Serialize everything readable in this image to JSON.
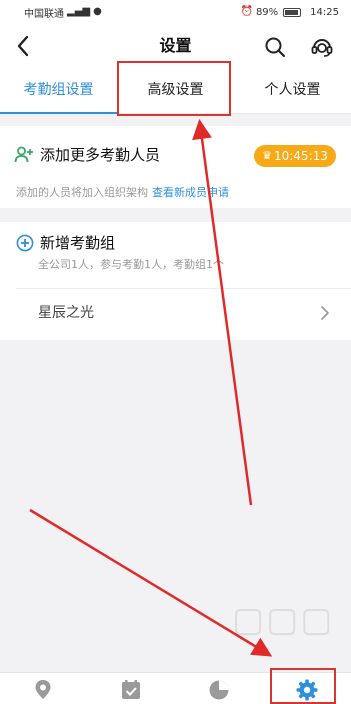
{
  "status_bar": {
    "carrier": "中国联通",
    "battery": "89%",
    "time": "14:25"
  },
  "header": {
    "title": "设置"
  },
  "tabs": [
    {
      "label": "考勤组设置",
      "active": true
    },
    {
      "label": "高级设置",
      "active": false
    },
    {
      "label": "个人设置",
      "active": false
    }
  ],
  "add_member": {
    "title": "添加更多考勤人员",
    "timer": "10:45:13",
    "note": "添加的人员将加入组织架构",
    "note_link": "查看新成员申请"
  },
  "group": {
    "new_title": "新增考勤组",
    "summary": "全公司1人，参与考勤1人，考勤组1个",
    "items": [
      {
        "name": "星辰之光"
      }
    ]
  },
  "tabbar": {
    "items": [
      {
        "icon": "location-icon"
      },
      {
        "icon": "calendar-check-icon"
      },
      {
        "icon": "stats-pie-icon"
      },
      {
        "icon": "settings-gear-icon",
        "active": true
      }
    ]
  },
  "colors": {
    "accent": "#2f8fdc",
    "badge": "#f8a917",
    "annotation": "#d93434",
    "add_icon": "#3aa86b"
  }
}
